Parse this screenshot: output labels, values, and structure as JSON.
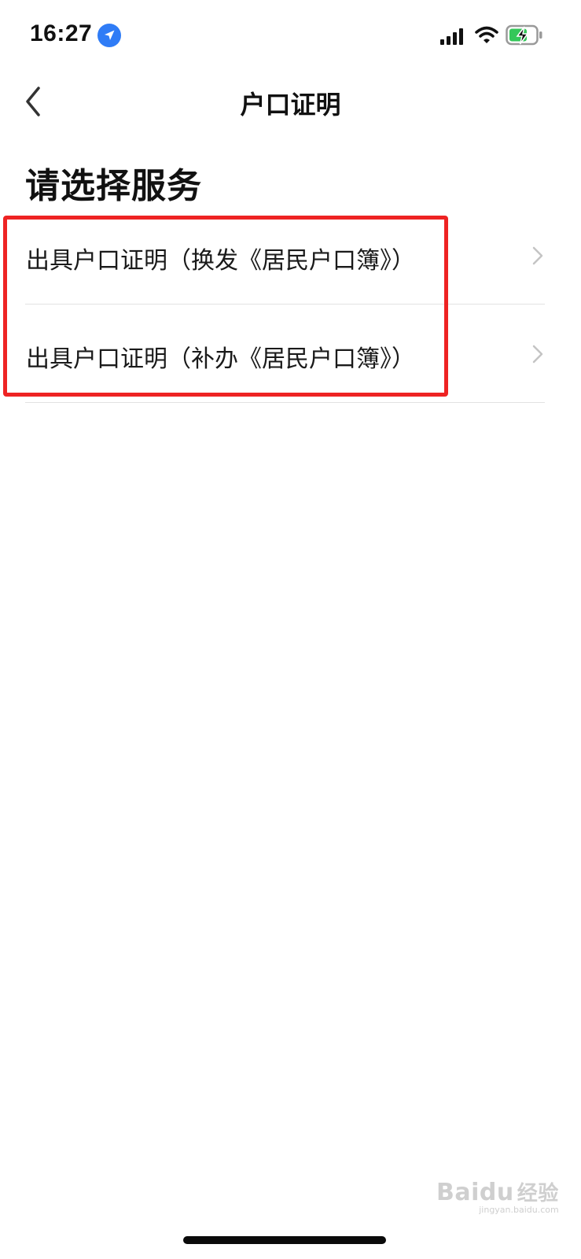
{
  "status_bar": {
    "time": "16:27"
  },
  "nav": {
    "title": "户口证明"
  },
  "main": {
    "section_title": "请选择服务",
    "services": [
      {
        "label": "出具户口证明（换发《居民户口簿》）"
      },
      {
        "label": "出具户口证明（补办《居民户口簿》）"
      }
    ]
  },
  "watermark": {
    "brand": "Baidu",
    "brand_cn": "经验",
    "site": "jingyan.baidu.com"
  },
  "colors": {
    "accent_blue": "#2f7cf6",
    "highlight_red": "#ee2323",
    "battery_green": "#34c759"
  },
  "icons": [
    "location-arrow-icon",
    "cellular-signal-icon",
    "wifi-icon",
    "battery-charging-icon",
    "back-chevron-icon",
    "chevron-right-icon"
  ]
}
